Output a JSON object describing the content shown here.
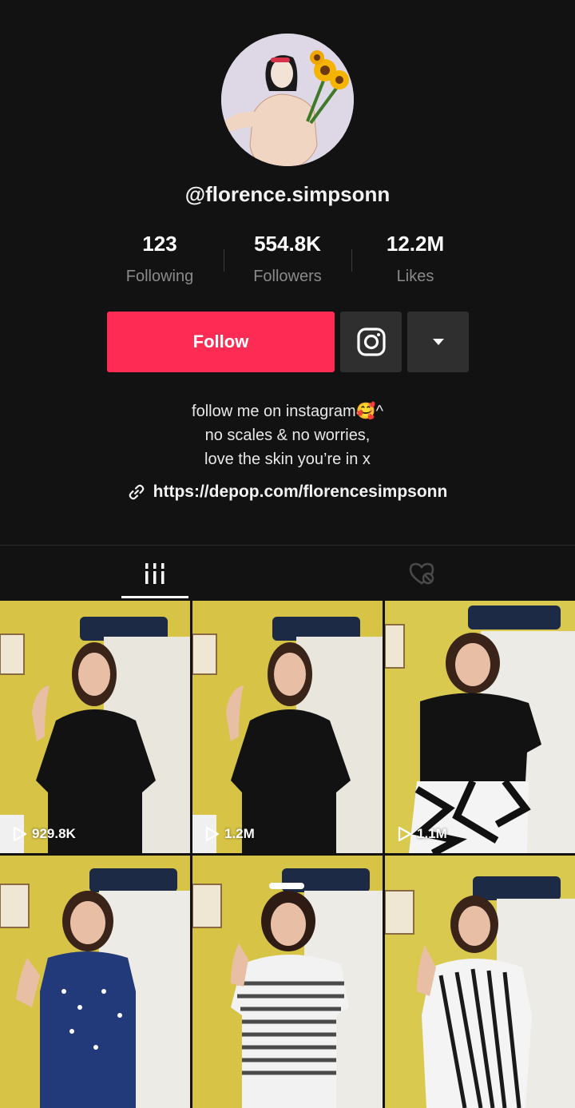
{
  "profile": {
    "username": "@florence.simpsonn",
    "avatar_icon": "illustrated-woman-with-sunflowers"
  },
  "stats": [
    {
      "value": "123",
      "label": "Following"
    },
    {
      "value": "554.8K",
      "label": "Followers"
    },
    {
      "value": "12.2M",
      "label": "Likes"
    }
  ],
  "actions": {
    "follow_label": "Follow",
    "instagram_icon": "instagram-icon",
    "more_icon": "caret-down-icon",
    "follow_color": "#fe2c55"
  },
  "bio": {
    "line1": "follow me on instagram🥰^",
    "line2": "no scales & no worries,",
    "line3": "love the skin you’re in x"
  },
  "link": {
    "icon": "link-icon",
    "url": "https://depop.com/florencesimpsonn"
  },
  "tabs": [
    {
      "icon": "videos-grid-icon",
      "active": true
    },
    {
      "icon": "liked-hidden-icon",
      "active": false
    }
  ],
  "videos": [
    {
      "views": "929.8K",
      "outfit": "black-dress"
    },
    {
      "views": "1.2M",
      "outfit": "black-dress"
    },
    {
      "views": "1.1M",
      "outfit": "black-top-zebra-skirt"
    },
    {
      "views": "",
      "outfit": "navy-polka-dot-dress"
    },
    {
      "views": "",
      "outfit": "striped-tee"
    },
    {
      "views": "",
      "outfit": "striped-wrap-dress"
    }
  ]
}
